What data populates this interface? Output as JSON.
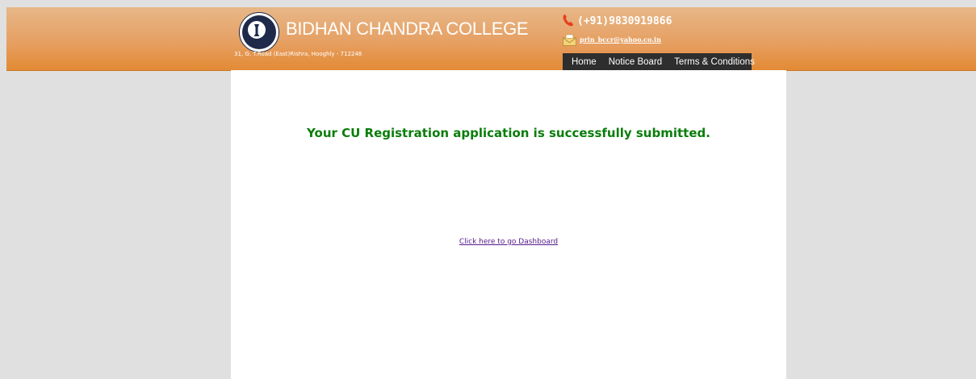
{
  "header": {
    "college_name": "BIDHAN CHANDRA COLLEGE",
    "address": "31, G. T.Road (East)Rishra, Hooghly - 712248",
    "phone": "(+91)9830919866",
    "email": "prin_bccr@yahoo.co.in",
    "logo_icon": "college-seal-icon",
    "phone_icon": "phone-icon",
    "mail_icon": "mail-icon"
  },
  "nav": {
    "items": [
      "Home",
      "Notice Board",
      "Terms & Conditions"
    ]
  },
  "main": {
    "success_message": "Your CU Registration application is successfully submitted.",
    "dashboard_link": "Click here to go Dashboard"
  },
  "colors": {
    "header_orange": "#e6a063",
    "nav_bg": "#2e2e2e",
    "success_green": "#0a7d0a",
    "page_bg": "#e0e0e0",
    "link_visited": "#551a8b"
  }
}
